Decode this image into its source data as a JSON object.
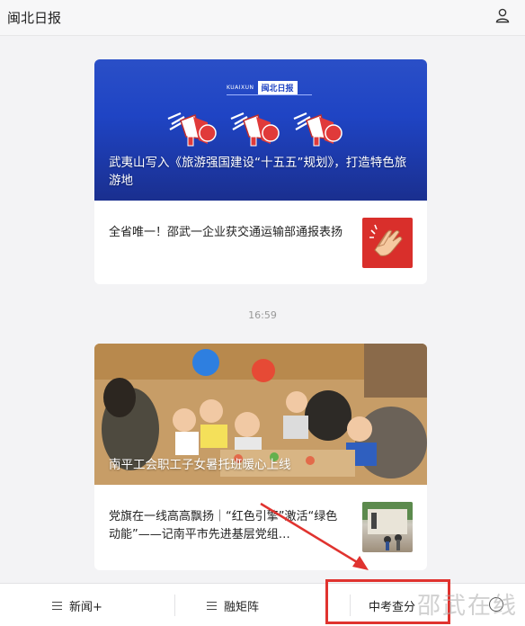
{
  "header": {
    "title": "闽北日报"
  },
  "banner": {
    "tag": "KUAIXUN",
    "paper": "闽北日报"
  },
  "feed": {
    "group1": {
      "lead": {
        "title": "武夷山写入《旅游强国建设“十五五”规划》，打造特色旅游地"
      },
      "item": {
        "title": "全省唯一！邵武一企业获交通运输部通报表扬"
      }
    },
    "time": "16:59",
    "group2": {
      "lead": {
        "title": "南平工会职工子女暑托班暖心上线"
      },
      "item": {
        "title": "党旗在一线高高飘扬｜“红色引擎”激活“绿色动能”——记南平市先进基层党组…"
      }
    }
  },
  "bottom_nav": {
    "tabs": [
      {
        "label": "新闻+"
      },
      {
        "label": "融矩阵"
      },
      {
        "label": "中考查分"
      }
    ]
  },
  "watermark": "邵武在线",
  "colors": {
    "banner_blue": "#1f44c4",
    "highlight_red": "#e0332f",
    "thumb_red": "#d92f2b"
  }
}
